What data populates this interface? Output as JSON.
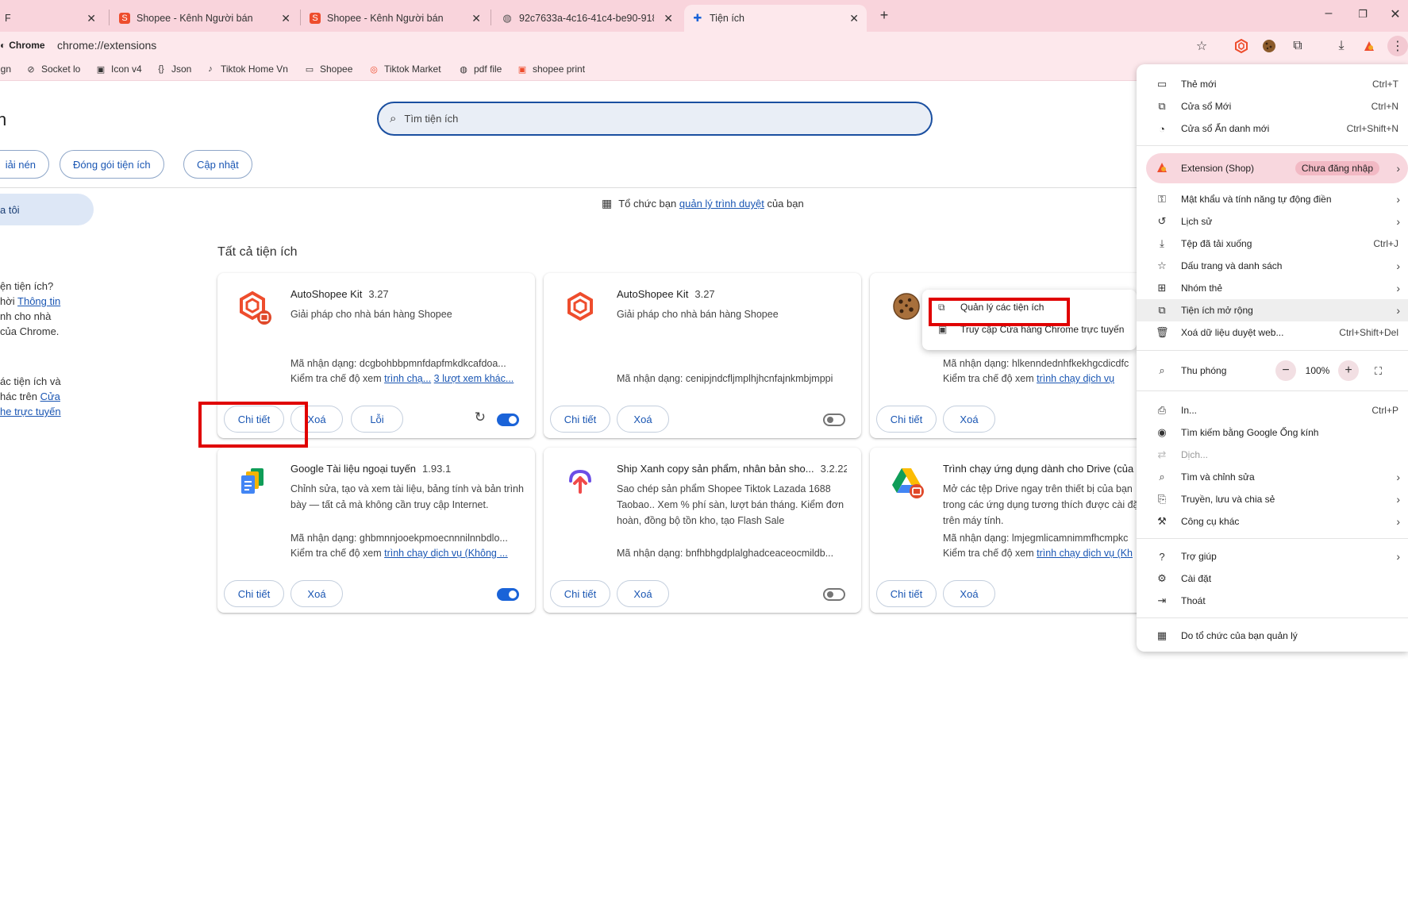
{
  "browser": {
    "tabs": [
      {
        "title": "F"
      },
      {
        "title": "Shopee - Kênh Người bán"
      },
      {
        "title": "Shopee - Kênh Người bán"
      },
      {
        "title": "92c7633a-4c16-41c4-be90-918"
      },
      {
        "title": "Tiện ích"
      }
    ],
    "chip_label": "Chrome",
    "url": "chrome://extensions",
    "bookmarks": [
      "ign",
      "Socket lo",
      "Icon v4",
      "Json",
      "Tiktok Home Vn",
      "Shopee",
      "Tiktok Market",
      "pdf file",
      "shopee print"
    ]
  },
  "page": {
    "title": "h",
    "search_placeholder": "Tìm tiện ích",
    "toolbar_buttons": [
      "iải nén",
      "Đóng gói tiện ích",
      "Cập nhật"
    ],
    "sidebar_selected": "a tôi",
    "sidebar_text1": [
      "ện tiện ích?",
      "hời ",
      "nh cho nhà",
      " của Chrome."
    ],
    "sidebar_link1": "Thông tin",
    "sidebar_text2": [
      "ác tiện ích và",
      "hác trên "
    ],
    "sidebar_link2a": "Cửa",
    "sidebar_link2b": "he trực tuyến",
    "managed_prefix": "Tổ chức bạn ",
    "managed_link": "quản lý trình duyệt",
    "managed_suffix": " của bạn",
    "section_title": "Tất cả tiện ích"
  },
  "cards": [
    {
      "name": "AutoShopee Kit",
      "version": "3.27",
      "desc": "Giải pháp cho nhà bán hàng Shopee",
      "id_line": "Mã nhận dạng: dcgbohbbpmnfdapfmkdkcafdoa...",
      "inspect_prefix": "Kiểm tra chế độ xem ",
      "inspect_link": "trình chạ...",
      "inspect_link2": "3 lượt xem khác...",
      "btn_details": "Chi tiết",
      "btn_remove": "Xoá",
      "btn_error": "Lỗi",
      "enabled": true
    },
    {
      "name": "AutoShopee Kit",
      "version": "3.27",
      "desc": "Giải pháp cho nhà bán hàng Shopee",
      "id_line": "Mã nhận dạng: cenipjndcfljmplhjhcnfajnkmbjmppi",
      "btn_details": "Chi tiết",
      "btn_remove": "Xoá",
      "enabled": false
    },
    {
      "id_line": "Mã nhận dạng: hlkenndednhfkekhgcdicdfc",
      "inspect_prefix": "Kiểm tra chế độ xem ",
      "inspect_link": "trình chạy dịch vụ",
      "btn_details": "Chi tiết",
      "btn_remove": "Xoá"
    },
    {
      "name": "Google Tài liệu ngoại tuyến",
      "version": "1.93.1",
      "desc": "Chỉnh sửa, tạo và xem tài liệu, bảng tính và bản trình bày — tất cả mà không cần truy cập Internet.",
      "id_line": "Mã nhận dạng: ghbmnnjooekpmoecnnnilnnbdlo...",
      "inspect_prefix": "Kiểm tra chế độ xem ",
      "inspect_link": "trình chạy dịch vụ (Không ...",
      "btn_details": "Chi tiết",
      "btn_remove": "Xoá",
      "enabled": true
    },
    {
      "name": "Ship Xanh copy sản phẩm, nhân bản sho...",
      "version": "3.2.22",
      "desc": "Sao chép sản phẩm Shopee Tiktok Lazada 1688 Taobao.. Xem % phí sàn, lượt bán tháng. Kiểm đơn hoàn, đồng bộ tồn kho, tạo Flash Sale",
      "id_line": "Mã nhận dạng: bnfhbhgdplalghadceaceocmildb...",
      "btn_details": "Chi tiết",
      "btn_remove": "Xoá",
      "enabled": false
    },
    {
      "name": "Trình chạy ứng dụng dành cho Drive (của ...",
      "desc": "Mở các tệp Drive ngay trên thiết bị của bạn trong các ứng dụng tương thích được cài đặt trên máy tính.",
      "id_line": "Mã nhận dạng: lmjegmlicamnimmfhcmpkc",
      "inspect_prefix": "Kiểm tra chế độ xem ",
      "inspect_link": "trình chạy dịch vụ (Kh",
      "btn_details": "Chi tiết",
      "btn_remove": "Xoá"
    }
  ],
  "submenu": {
    "manage": "Quản lý các tiện ích",
    "store": "Truy cập Cửa hàng Chrome trực tuyến"
  },
  "menu": {
    "new_tab": "Thẻ mới",
    "new_tab_sc": "Ctrl+T",
    "new_window": "Cửa sổ Mới",
    "new_window_sc": "Ctrl+N",
    "incognito": "Cửa sổ Ẩn danh mới",
    "incognito_sc": "Ctrl+Shift+N",
    "profile": "Extension (Shop)",
    "profile_status": "Chưa đăng nhập",
    "passwords": "Mật khẩu và tính năng tự động điền",
    "history": "Lịch sử",
    "downloads": "Tệp đã tải xuống",
    "downloads_sc": "Ctrl+J",
    "bookmarks": "Dấu trang và danh sách",
    "tab_groups": "Nhóm thẻ",
    "extensions": "Tiện ích mở rộng",
    "clear_data": "Xoá dữ liệu duyệt web...",
    "clear_data_sc": "Ctrl+Shift+Del",
    "zoom": "Thu phóng",
    "zoom_value": "100%",
    "print": "In...",
    "print_sc": "Ctrl+P",
    "lens": "Tìm kiếm bằng Google Ống kính",
    "translate": "Dịch...",
    "find": "Tìm và chỉnh sửa",
    "cast": "Truyền, lưu và chia sẻ",
    "more_tools": "Công cụ khác",
    "help": "Trợ giúp",
    "settings": "Cài đặt",
    "exit": "Thoát",
    "managed": "Do tổ chức của bạn quản lý"
  },
  "colors": {
    "accent": "#1a63d8",
    "highlight_box": "#e00000",
    "tabbar": "#f9d4dc",
    "shopee": "#ee4d2d"
  }
}
